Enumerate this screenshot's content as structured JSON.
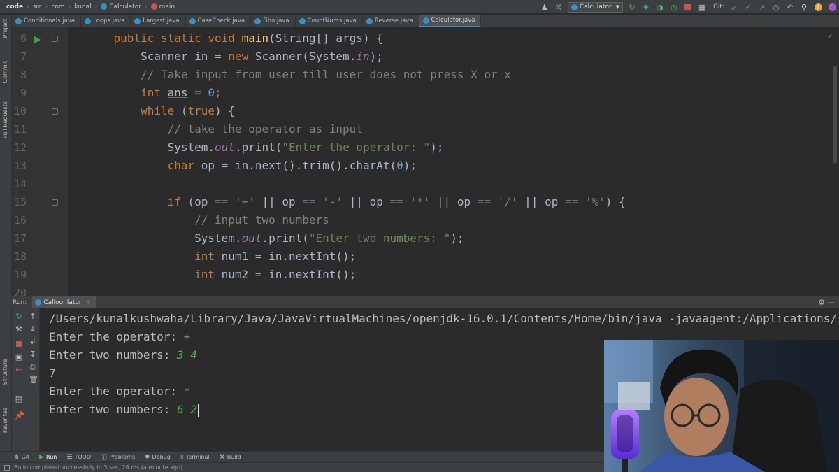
{
  "breadcrumbs": [
    "code",
    "src",
    "com",
    "kunal",
    "Calculator",
    "main"
  ],
  "toolbar": {
    "run_config": "Calculator",
    "git_label": "Git:"
  },
  "tabs": [
    {
      "label": "Conditionals.java",
      "active": false
    },
    {
      "label": "Loops.java",
      "active": false
    },
    {
      "label": "Largest.java",
      "active": false
    },
    {
      "label": "CaseCheck.java",
      "active": false
    },
    {
      "label": "Fibo.java",
      "active": false
    },
    {
      "label": "CountNums.java",
      "active": false
    },
    {
      "label": "Reverse.java",
      "active": false
    },
    {
      "label": "Calculator.java",
      "active": true
    }
  ],
  "left_tool_windows": [
    "Project",
    "Commit",
    "Pull Requests",
    "Structure",
    "Favorites"
  ],
  "editor": {
    "lines": [
      {
        "n": "6",
        "tokens": [
          [
            "",
            "    "
          ],
          [
            "kw",
            "public static void "
          ],
          [
            "fn",
            "main"
          ],
          [
            "",
            "(String[] args) {"
          ]
        ]
      },
      {
        "n": "7",
        "tokens": [
          [
            "",
            "        Scanner in = "
          ],
          [
            "kw",
            "new "
          ],
          [
            "",
            "Scanner(System."
          ],
          [
            "fi",
            "in"
          ],
          [
            "",
            ");"
          ]
        ]
      },
      {
        "n": "8",
        "tokens": [
          [
            "cm",
            "        // Take input from user till user does not press X or x"
          ]
        ]
      },
      {
        "n": "9",
        "tokens": [
          [
            "",
            "        "
          ],
          [
            "kw",
            "int "
          ],
          [
            "ul",
            "ans"
          ],
          [
            "",
            " = "
          ],
          [
            "nm",
            "0"
          ],
          [
            "kw",
            ";"
          ]
        ]
      },
      {
        "n": "10",
        "tokens": [
          [
            "",
            "        "
          ],
          [
            "kw",
            "while "
          ],
          [
            "",
            "("
          ],
          [
            "kw",
            "true"
          ],
          [
            "",
            ") {"
          ]
        ]
      },
      {
        "n": "11",
        "tokens": [
          [
            "cm",
            "            // take the operator as input"
          ]
        ]
      },
      {
        "n": "12",
        "tokens": [
          [
            "",
            "            System."
          ],
          [
            "fi",
            "out"
          ],
          [
            "",
            ".print("
          ],
          [
            "st",
            "\"Enter the operator: \""
          ],
          [
            "",
            ");"
          ]
        ]
      },
      {
        "n": "13",
        "tokens": [
          [
            "",
            "            "
          ],
          [
            "kw",
            "char "
          ],
          [
            "",
            "op = in.next().trim().charAt("
          ],
          [
            "nm",
            "0"
          ],
          [
            "",
            ");"
          ]
        ]
      },
      {
        "n": "14",
        "tokens": [
          [
            "",
            ""
          ]
        ]
      },
      {
        "n": "15",
        "tokens": [
          [
            "",
            "            "
          ],
          [
            "kw",
            "if "
          ],
          [
            "",
            "(op == "
          ],
          [
            "st",
            "'+'"
          ],
          [
            "",
            " || op == "
          ],
          [
            "st",
            "'-'"
          ],
          [
            "",
            " || op == "
          ],
          [
            "st",
            "'*'"
          ],
          [
            "",
            " || op == "
          ],
          [
            "st",
            "'/'"
          ],
          [
            "",
            " || op == "
          ],
          [
            "st",
            "'%'"
          ],
          [
            "",
            ") {"
          ]
        ]
      },
      {
        "n": "16",
        "tokens": [
          [
            "cm",
            "                // input two numbers"
          ]
        ]
      },
      {
        "n": "17",
        "tokens": [
          [
            "",
            "                System."
          ],
          [
            "fi",
            "out"
          ],
          [
            "",
            ".print("
          ],
          [
            "st",
            "\"Enter two numbers: \""
          ],
          [
            "",
            ");"
          ]
        ]
      },
      {
        "n": "18",
        "tokens": [
          [
            "",
            "                "
          ],
          [
            "kw",
            "int "
          ],
          [
            "",
            "num1 = in.nextInt();"
          ]
        ]
      },
      {
        "n": "19",
        "tokens": [
          [
            "",
            "                "
          ],
          [
            "kw",
            "int "
          ],
          [
            "",
            "num2 = in.nextInt();"
          ]
        ]
      },
      {
        "n": "20",
        "tokens": [
          [
            "",
            ""
          ]
        ]
      }
    ]
  },
  "run_panel": {
    "label": "Run:",
    "tab": "Calloonlator"
  },
  "console": {
    "lines": [
      {
        "text": "/Users/kunalkushwaha/Library/Java/JavaVirtualMachines/openjdk-16.0.1/Contents/Home/bin/java -javaagent:/Applications/",
        "input": ""
      },
      {
        "text": "Enter the operator: ",
        "input": "+"
      },
      {
        "text": "Enter two numbers: ",
        "input": "3 4"
      },
      {
        "text": "7",
        "input": ""
      },
      {
        "text": "Enter the operator: ",
        "input": "*"
      },
      {
        "text": "Enter two numbers: ",
        "input": "6 2"
      }
    ]
  },
  "bottom_tabs": [
    "Git",
    "Run",
    "TODO",
    "Problems",
    "Debug",
    "Terminal",
    "Build"
  ],
  "status": "Build completed successfully in 3 sec, 28 ms (a minute ago)"
}
